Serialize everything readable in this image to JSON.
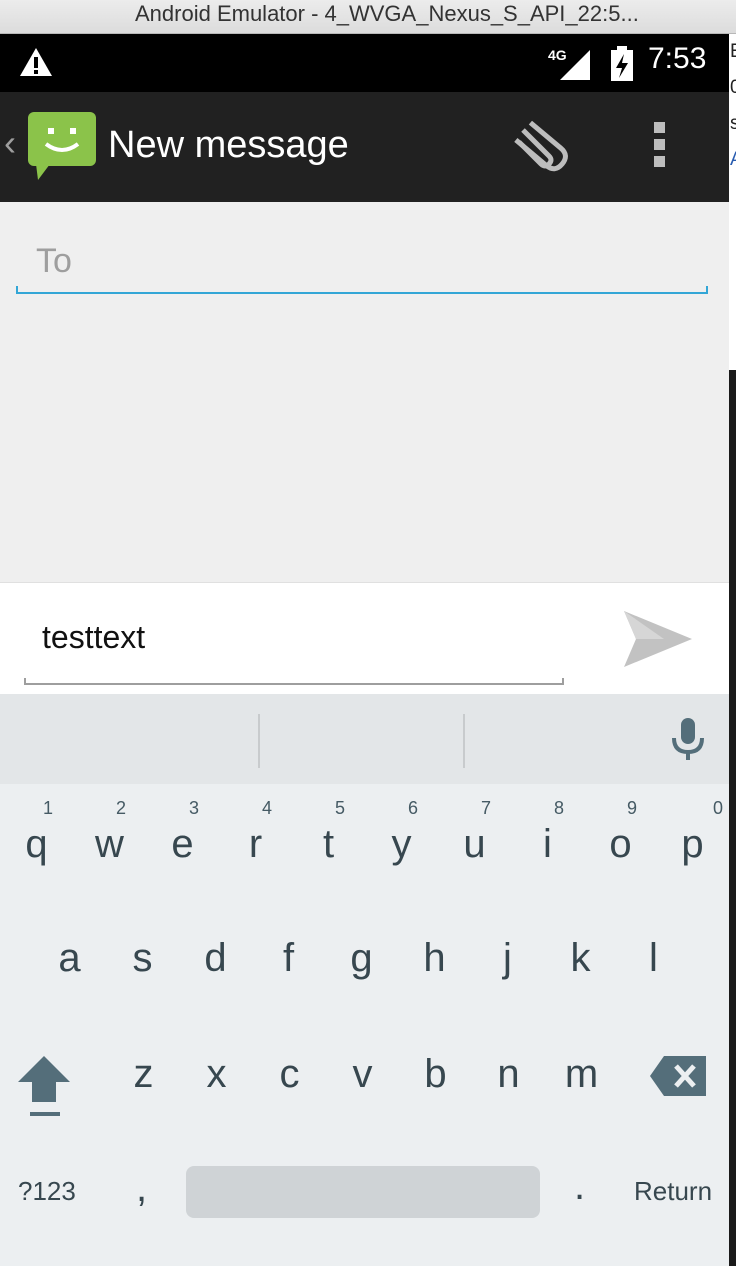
{
  "window": {
    "title": "Android Emulator - 4_WVGA_Nexus_S_API_22:5..."
  },
  "peek": {
    "lines": [
      "E",
      "0",
      "s",
      "A"
    ]
  },
  "status_bar": {
    "time": "7:53",
    "network": "4G",
    "alert_icon": "warning-icon"
  },
  "action_bar": {
    "back_glyph": "‹",
    "title": "New message",
    "icons": [
      "messaging-app-icon",
      "attach-icon",
      "overflow-menu-icon"
    ]
  },
  "recipient": {
    "placeholder": "To",
    "value": ""
  },
  "composer": {
    "text": "testtext",
    "send_icon": "send-icon"
  },
  "keyboard": {
    "row1": [
      {
        "ch": "q",
        "hint": "1"
      },
      {
        "ch": "w",
        "hint": "2"
      },
      {
        "ch": "e",
        "hint": "3"
      },
      {
        "ch": "r",
        "hint": "4"
      },
      {
        "ch": "t",
        "hint": "5"
      },
      {
        "ch": "y",
        "hint": "6"
      },
      {
        "ch": "u",
        "hint": "7"
      },
      {
        "ch": "i",
        "hint": "8"
      },
      {
        "ch": "o",
        "hint": "9"
      },
      {
        "ch": "p",
        "hint": "0"
      }
    ],
    "row2": [
      "a",
      "s",
      "d",
      "f",
      "g",
      "h",
      "j",
      "k",
      "l"
    ],
    "row3": [
      "z",
      "x",
      "c",
      "v",
      "b",
      "n",
      "m"
    ],
    "symbols_label": "?123",
    "comma": ",",
    "period": ".",
    "return_label": "Return"
  },
  "colors": {
    "accent": "#33a6d6",
    "action_bar": "#212121",
    "logo_green": "#8bc34a"
  }
}
